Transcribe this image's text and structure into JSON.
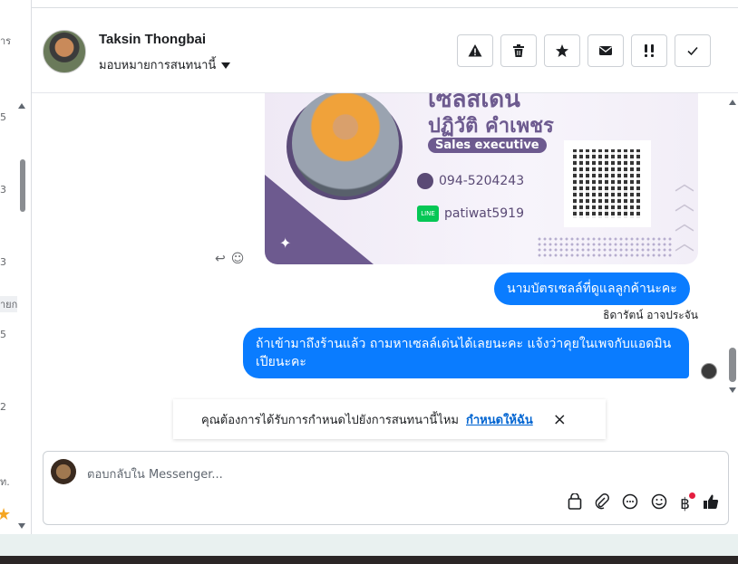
{
  "left_panel": {
    "fragments": [
      "าร",
      "5",
      "3",
      "3",
      "ายก",
      "5",
      "2",
      "ท."
    ]
  },
  "header": {
    "contact_name": "Taksin Thongbai",
    "assign_label": "มอบหมายการสนทนานี้",
    "tools": [
      {
        "name": "spam-button",
        "icon": "warning-icon"
      },
      {
        "name": "delete-button",
        "icon": "trash-icon"
      },
      {
        "name": "star-button",
        "icon": "star-icon"
      },
      {
        "name": "mark-unread-button",
        "icon": "envelope-icon"
      },
      {
        "name": "follow-up-button",
        "icon": "exclamation-icon"
      },
      {
        "name": "done-button",
        "icon": "check-icon"
      }
    ]
  },
  "card": {
    "heading_line1": "เซลส์เด่น",
    "heading_line2": "ปฏิวัติ  คำเพชร",
    "role": "Sales executive",
    "phone": "094-5204243",
    "line_badge": "LINE",
    "line_id": "patiwat5919"
  },
  "messages": [
    {
      "text": "นามบัตรเซลล์ที่ดูแลลูกค้านะคะ"
    },
    {
      "text": "ถ้าเข้ามาถึงร้านแล้ว ถามหาเซลล์เด่นได้เลยนะคะ แจ้งว่าคุยในเพจกับแอดมินเปียนะคะ"
    }
  ],
  "sender_name": "ธิดารัตน์ อาจประจัน",
  "notice": {
    "text": "คุณต้องการได้รับการกำหนดไปยังการสนทนานี้ไหม",
    "link": "กำหนดให้ฉัน",
    "close": "×"
  },
  "composer": {
    "placeholder": "ตอบกลับใน Messenger...",
    "baht_symbol": "฿"
  },
  "colors": {
    "bubble": "#0a7cff",
    "link": "#0064d1",
    "card_accent": "#6d5a8f"
  }
}
